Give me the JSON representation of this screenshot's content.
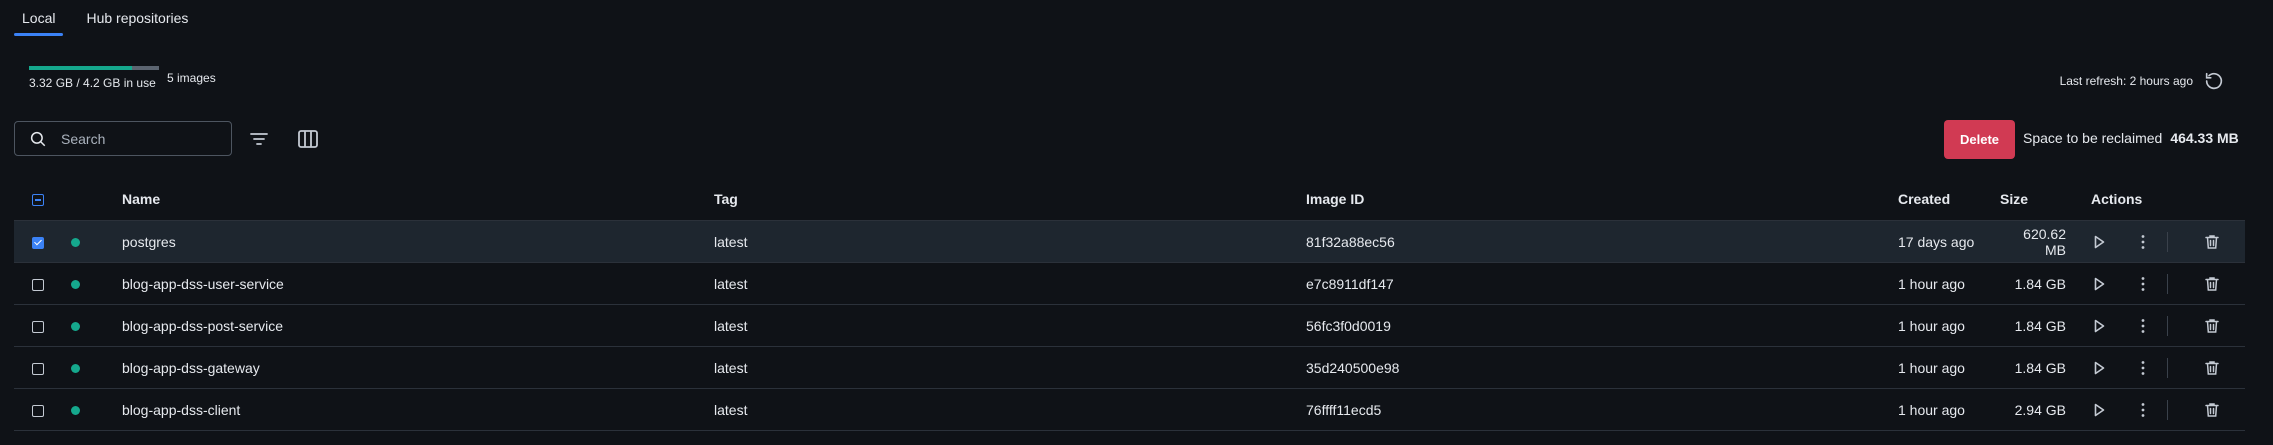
{
  "tabs": [
    {
      "label": "Local",
      "active": true
    },
    {
      "label": "Hub repositories",
      "active": false
    }
  ],
  "usage": {
    "text": "3.32 GB / 4.2 GB in use",
    "images": "5 images",
    "fraction_used": 0.79
  },
  "refresh": {
    "text": "Last refresh: 2 hours ago"
  },
  "search": {
    "placeholder": "Search"
  },
  "actions": {
    "delete_label": "Delete",
    "reclaim_label": "Space to be reclaimed",
    "reclaim_value": "464.33 MB"
  },
  "table": {
    "headers": {
      "name": "Name",
      "tag": "Tag",
      "image_id": "Image ID",
      "created": "Created",
      "size": "Size",
      "actions": "Actions"
    },
    "rows": [
      {
        "name": "postgres",
        "tag": "latest",
        "image_id": "81f32a88ec56",
        "created": "17 days ago",
        "size": "620.62 MB",
        "selected": true
      },
      {
        "name": "blog-app-dss-user-service",
        "tag": "latest",
        "image_id": "e7c8911df147",
        "created": "1 hour ago",
        "size": "1.84 GB",
        "selected": false
      },
      {
        "name": "blog-app-dss-post-service",
        "tag": "latest",
        "image_id": "56fc3f0d0019",
        "created": "1 hour ago",
        "size": "1.84 GB",
        "selected": false
      },
      {
        "name": "blog-app-dss-gateway",
        "tag": "latest",
        "image_id": "35d240500e98",
        "created": "1 hour ago",
        "size": "1.84 GB",
        "selected": false
      },
      {
        "name": "blog-app-dss-client",
        "tag": "latest",
        "image_id": "76ffff11ecd5",
        "created": "1 hour ago",
        "size": "2.94 GB",
        "selected": false
      }
    ]
  },
  "colors": {
    "accent": "#3b82f6",
    "delete": "#d13a53",
    "status": "#15a88d",
    "background": "#0f1217"
  }
}
